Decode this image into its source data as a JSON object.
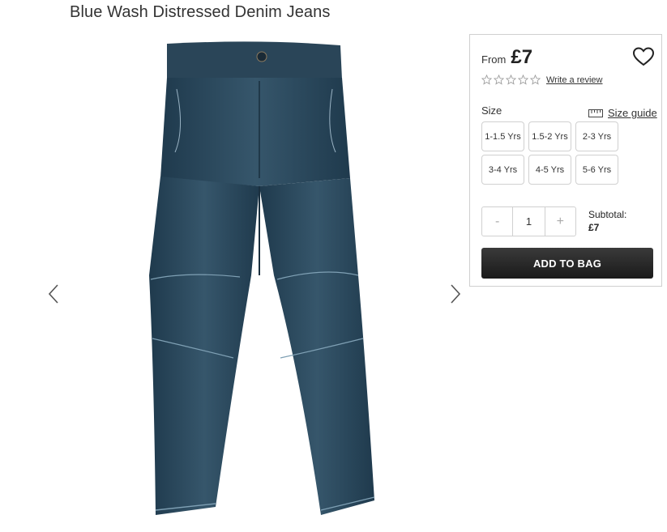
{
  "product": {
    "title": "Blue Wash Distressed Denim Jeans",
    "image_alt": "denim jeans product photo"
  },
  "gallery": {
    "prev_icon": "chevron-left-icon",
    "next_icon": "chevron-right-icon"
  },
  "buy_panel": {
    "from_label": "From",
    "price": "£7",
    "wishlist_icon": "heart-icon",
    "rating_stars": 0,
    "rating_max": 5,
    "write_review_label": "Write a review",
    "size_label": "Size",
    "size_guide_label": "Size guide",
    "size_guide_icon": "ruler-icon",
    "sizes": [
      "1-1.5 Yrs",
      "1.5-2 Yrs",
      "2-3 Yrs",
      "3-4 Yrs",
      "4-5 Yrs",
      "5-6 Yrs"
    ],
    "quantity": {
      "minus": "-",
      "value": "1",
      "plus": "+"
    },
    "subtotal_label": "Subtotal:",
    "subtotal_value": "£7",
    "add_to_bag_label": "ADD TO BAG"
  },
  "colors": {
    "denim": "#2b4a5e",
    "button_dark": "#222222",
    "border": "#d0d0d0"
  }
}
